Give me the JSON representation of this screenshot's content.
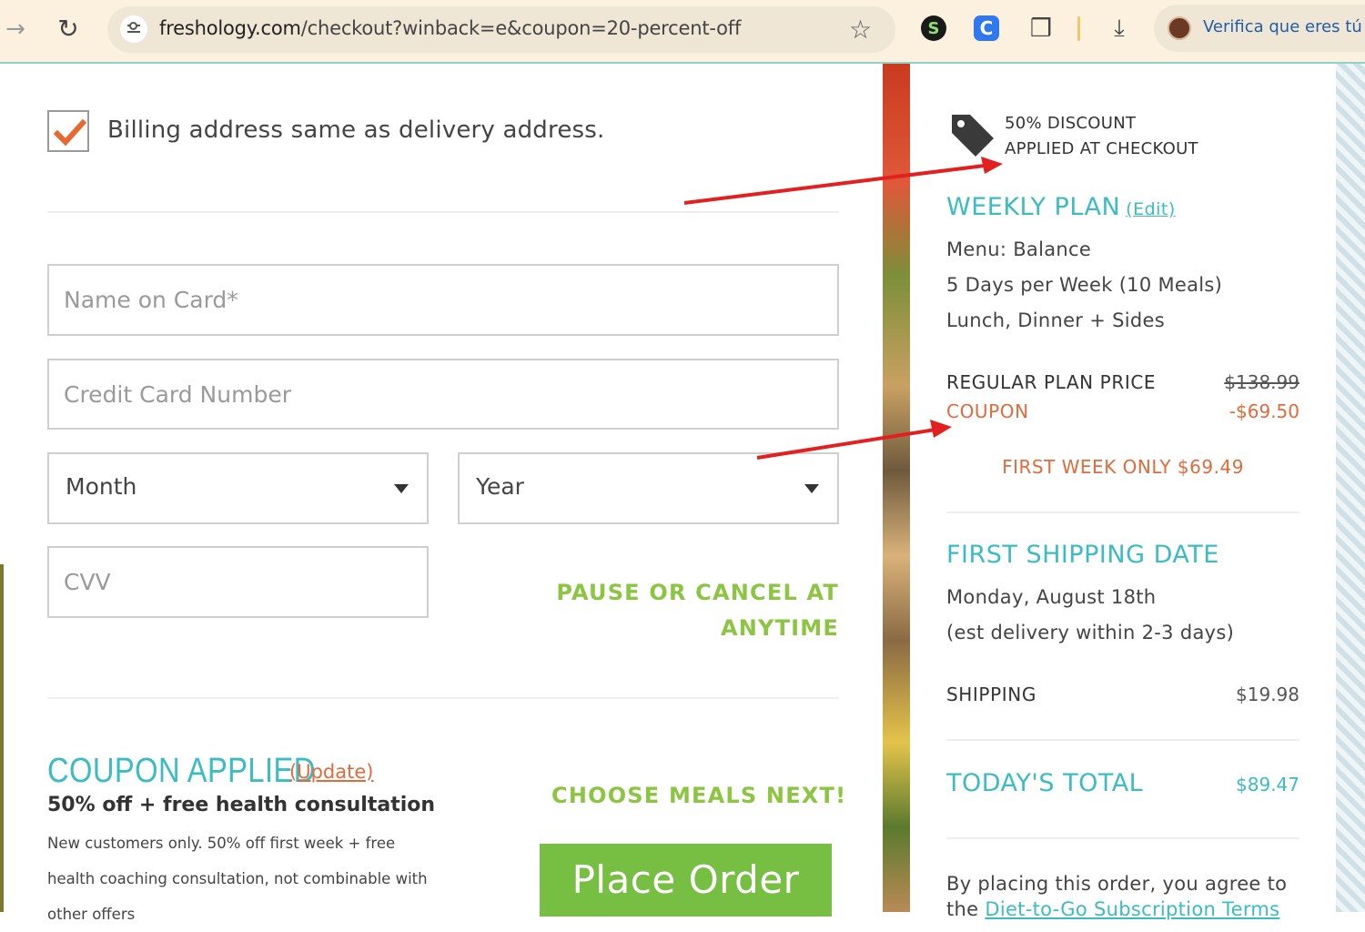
{
  "browser": {
    "url_host": "freshology.com",
    "url_path": "/checkout?winback=e&coupon=20-percent-off",
    "profile_label": "Verifica que eres tú",
    "ext_s_letter": "S",
    "ext_c_letter": "C"
  },
  "form": {
    "billing_same_label": "Billing address same as delivery address.",
    "billing_same_checked": true,
    "name_placeholder": "Name on Card*",
    "card_placeholder": "Credit Card Number",
    "month_value": "Month",
    "year_value": "Year",
    "cvv_placeholder": "CVV",
    "pause_line1": "PAUSE OR CANCEL AT",
    "pause_line2": "ANYTIME",
    "coupon_title": "COUPON APPLIED",
    "coupon_update": "(Update)",
    "coupon_subtitle": "50% off + free health consultation",
    "coupon_desc": "New customers only. 50% off first week + free health coaching consultation, not combinable with other offers",
    "choose_meals": "CHOOSE MEALS NEXT!",
    "place_order": "Place Order"
  },
  "summary": {
    "discount_line1": "50% DISCOUNT",
    "discount_line2": "APPLIED AT CHECKOUT",
    "weekly_plan_title": "WEEKLY PLAN",
    "edit_link": "(Edit)",
    "menu": "Menu: Balance",
    "days": "5 Days per Week (10 Meals)",
    "meals": "Lunch, Dinner + Sides",
    "regular_label": "REGULAR PLAN PRICE",
    "regular_value": "$138.99",
    "coupon_label": "COUPON",
    "coupon_value": "-$69.50",
    "first_week": "FIRST WEEK ONLY $69.49",
    "shipping_title": "FIRST SHIPPING DATE",
    "ship_date": "Monday, August 18th",
    "ship_est": "(est delivery within 2-3 days)",
    "shipping_label": "SHIPPING",
    "shipping_value": "$19.98",
    "total_label": "TODAY'S TOTAL",
    "total_value": "$89.47",
    "agree_line1": "By placing this order, you agree to",
    "agree_line2_prefix": "the ",
    "agree_link": "Diet-to-Go Subscription Terms"
  },
  "colors": {
    "accent_teal": "#3bbcc3",
    "accent_orange": "#e26a3b",
    "accent_green": "#77bf42",
    "annotation_red": "#e32020"
  }
}
